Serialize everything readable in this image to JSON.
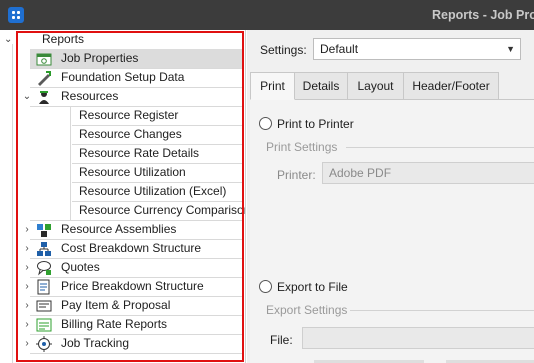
{
  "window": {
    "title": "Reports - Job Prop"
  },
  "tree": {
    "root_label": "Reports",
    "items": [
      {
        "label": "Job Properties",
        "icon": "job-properties-icon",
        "level": 1,
        "expandable": false,
        "selected": true
      },
      {
        "label": "Foundation Setup Data",
        "icon": "foundation-setup-icon",
        "level": 1,
        "expandable": false
      },
      {
        "label": "Resources",
        "icon": "resources-icon",
        "level": 1,
        "expandable": true,
        "expanded": true
      },
      {
        "label": "Resource Register",
        "level": 2
      },
      {
        "label": "Resource Changes",
        "level": 2
      },
      {
        "label": "Resource Rate Details",
        "level": 2
      },
      {
        "label": "Resource Utilization",
        "level": 2
      },
      {
        "label": "Resource Utilization (Excel)",
        "level": 2
      },
      {
        "label": "Resource Currency Comparison",
        "level": 2
      },
      {
        "label": "Resource Assemblies",
        "icon": "resource-assemblies-icon",
        "level": 1,
        "expandable": true
      },
      {
        "label": "Cost Breakdown Structure",
        "icon": "cost-breakdown-icon",
        "level": 1,
        "expandable": true
      },
      {
        "label": "Quotes",
        "icon": "quotes-icon",
        "level": 1,
        "expandable": true
      },
      {
        "label": "Price Breakdown Structure",
        "icon": "price-breakdown-icon",
        "level": 1,
        "expandable": true
      },
      {
        "label": "Pay Item & Proposal",
        "icon": "pay-item-icon",
        "level": 1,
        "expandable": true
      },
      {
        "label": "Billing Rate Reports",
        "icon": "billing-rate-icon",
        "level": 1,
        "expandable": true
      },
      {
        "label": "Job Tracking",
        "icon": "job-tracking-icon",
        "level": 1,
        "expandable": true
      }
    ]
  },
  "settings": {
    "label": "Settings:",
    "value": "Default"
  },
  "tabs": [
    {
      "label": "Print",
      "active": true
    },
    {
      "label": "Details"
    },
    {
      "label": "Layout"
    },
    {
      "label": "Header/Footer"
    }
  ],
  "print_tab": {
    "print_to_printer": "Print to Printer",
    "print_settings_title": "Print Settings",
    "printer_label": "Printer:",
    "printer_value": "Adobe PDF",
    "export_to_file": "Export to File",
    "export_settings_title": "Export Settings",
    "file_label": "File:",
    "file_value": ""
  },
  "colors": {
    "titlebar": "#3c3c3c",
    "highlight_border": "#e01010",
    "selected_row": "#dcdcdc",
    "app_icon": "#1f6fd1"
  }
}
